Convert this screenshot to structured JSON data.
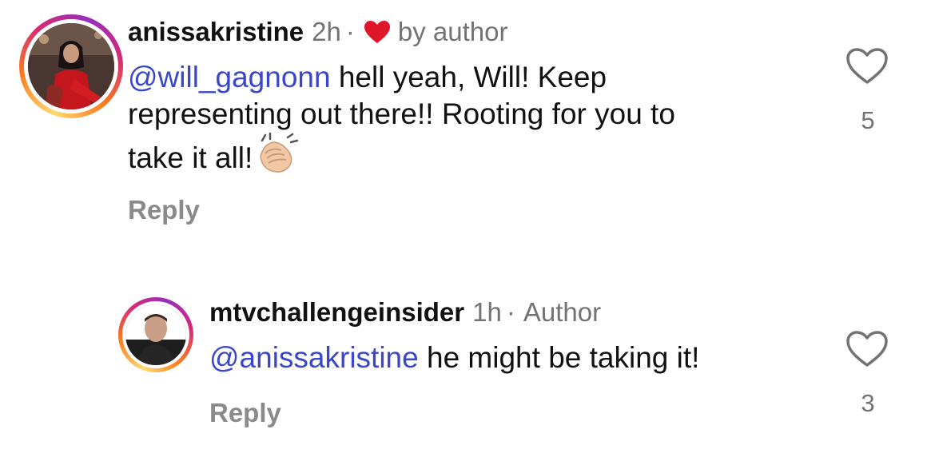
{
  "comments": [
    {
      "username": "anissakristine",
      "time": "2h",
      "separator": "·",
      "badge": "by author",
      "badge_icon": "red-heart-icon",
      "mention": "@will_gagnonn",
      "text_lines": [
        " hell yeah, Will! Keep",
        "representing out there!! Rooting for you to",
        "take it all!"
      ],
      "emoji": "clapping-hands-icon",
      "reply_label": "Reply",
      "like_count": "5"
    },
    {
      "username": "mtvchallengeinsider",
      "time": "1h",
      "separator": "·",
      "badge": "Author",
      "mention": "@anissakristine",
      "text": " he might be taking it!",
      "reply_label": "Reply",
      "like_count": "3"
    }
  ],
  "colors": {
    "mention": "#3b47c9",
    "heart": "#e0162b",
    "muted": "#737373",
    "reply": "#8a8a8a"
  }
}
